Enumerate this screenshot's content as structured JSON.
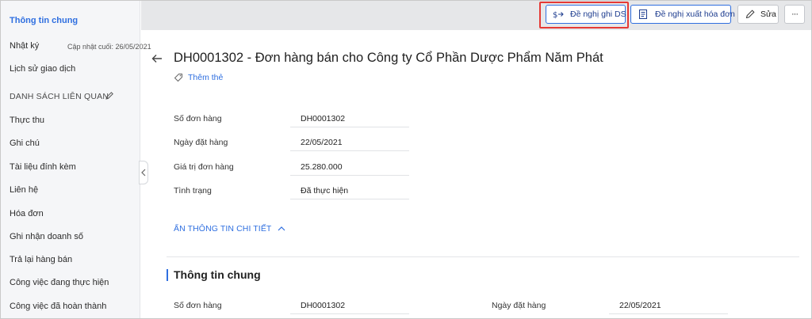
{
  "sidebar": {
    "active_item": "Thông tin chung",
    "journal_label": "Nhật ký",
    "journal_meta": "Cập nhật cuối: 26/05/2021",
    "history_label": "Lịch sử giao dịch",
    "section_title": "DANH SÁCH LIÊN QUAN",
    "items": [
      {
        "label": "Thực thu"
      },
      {
        "label": "Ghi chú"
      },
      {
        "label": "Tài liệu đính kèm"
      },
      {
        "label": "Liên hệ"
      },
      {
        "label": "Hóa đơn"
      },
      {
        "label": "Ghi nhận doanh số"
      },
      {
        "label": "Trả lại hàng bán"
      },
      {
        "label": "Công việc đang thực hiện"
      },
      {
        "label": "Công việc đã hoàn thành"
      }
    ]
  },
  "toolbar": {
    "propose_ds_label": "Đề nghị ghi DS",
    "propose_invoice_label": "Đề nghị xuất hóa đơn",
    "edit_label": "Sửa",
    "more_label": "···"
  },
  "main": {
    "title": "DH0001302 - Đơn hàng bán cho Công ty Cổ Phần Dược Phẩm Năm Phát",
    "add_tag_label": "Thêm thẻ",
    "fields": [
      {
        "label": "Số đơn hàng",
        "value": "DH0001302"
      },
      {
        "label": "Ngày đặt hàng",
        "value": "22/05/2021"
      },
      {
        "label": "Giá trị đơn hàng",
        "value": "25.280.000"
      },
      {
        "label": "Tình trạng",
        "value": "Đã thực hiện"
      }
    ],
    "hide_details_label": "ẨN THÔNG TIN CHI TIẾT",
    "general_section": {
      "title": "Thông tin chung",
      "fields": [
        {
          "label": "Số đơn hàng",
          "value": "DH0001302"
        },
        {
          "label": "Ngày đặt hàng",
          "value": "22/05/2021"
        }
      ]
    }
  },
  "colors": {
    "accent": "#2f6fe0",
    "highlight_box": "#e53935",
    "toolbar_bg": "#e6e7e9",
    "sidebar_bg": "#f5f6f8"
  }
}
